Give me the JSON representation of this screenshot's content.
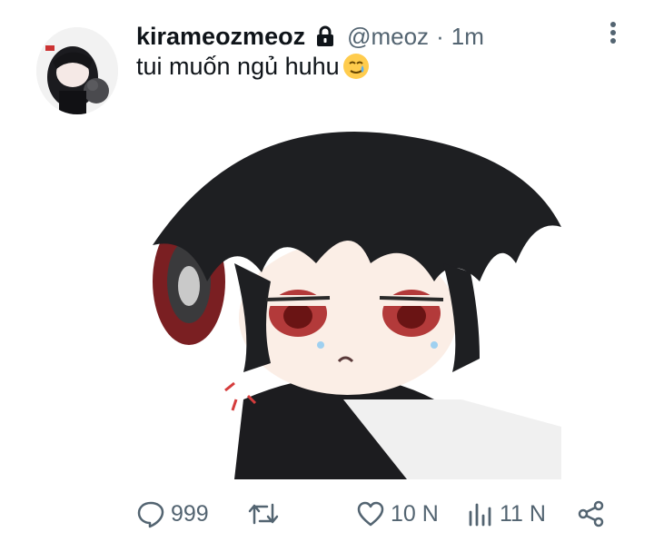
{
  "tweet": {
    "display_name": "kirameozmeoz",
    "handle": "@meoz",
    "separator": "·",
    "time": "1m",
    "text": "tui muốn ngủ huhu",
    "emoji": "smiling-face-with-tear",
    "protected_icon": "lock-icon",
    "more_icon": "more-vertical-icon"
  },
  "actions": {
    "reply": {
      "icon": "reply-icon",
      "count": "999"
    },
    "retweet": {
      "icon": "retweet-icon",
      "count": ""
    },
    "like": {
      "icon": "heart-icon",
      "count": "10 N"
    },
    "views": {
      "icon": "views-icon",
      "count": "11 N"
    },
    "share": {
      "icon": "share-icon"
    }
  },
  "colors": {
    "text": "#0f1419",
    "secondary": "#536471",
    "background": "#ffffff"
  }
}
